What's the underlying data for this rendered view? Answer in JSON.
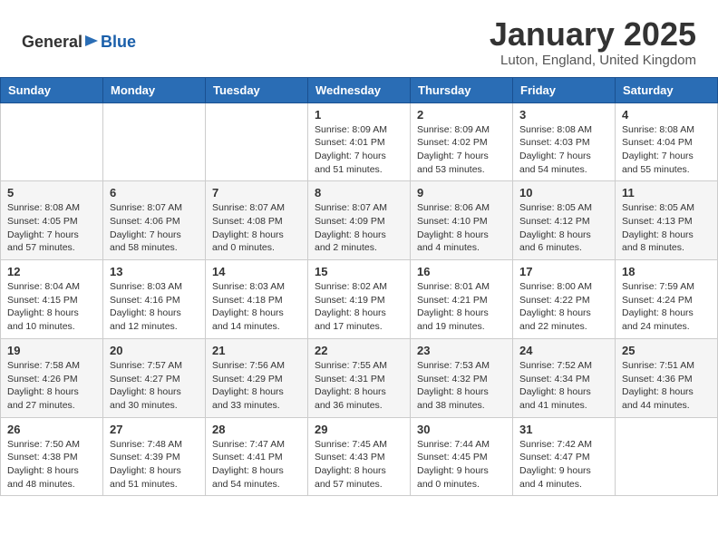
{
  "header": {
    "logo_general": "General",
    "logo_blue": "Blue",
    "month_title": "January 2025",
    "location": "Luton, England, United Kingdom"
  },
  "days_of_week": [
    "Sunday",
    "Monday",
    "Tuesday",
    "Wednesday",
    "Thursday",
    "Friday",
    "Saturday"
  ],
  "weeks": [
    [
      {
        "day": "",
        "info": ""
      },
      {
        "day": "",
        "info": ""
      },
      {
        "day": "",
        "info": ""
      },
      {
        "day": "1",
        "info": "Sunrise: 8:09 AM\nSunset: 4:01 PM\nDaylight: 7 hours\nand 51 minutes."
      },
      {
        "day": "2",
        "info": "Sunrise: 8:09 AM\nSunset: 4:02 PM\nDaylight: 7 hours\nand 53 minutes."
      },
      {
        "day": "3",
        "info": "Sunrise: 8:08 AM\nSunset: 4:03 PM\nDaylight: 7 hours\nand 54 minutes."
      },
      {
        "day": "4",
        "info": "Sunrise: 8:08 AM\nSunset: 4:04 PM\nDaylight: 7 hours\nand 55 minutes."
      }
    ],
    [
      {
        "day": "5",
        "info": "Sunrise: 8:08 AM\nSunset: 4:05 PM\nDaylight: 7 hours\nand 57 minutes."
      },
      {
        "day": "6",
        "info": "Sunrise: 8:07 AM\nSunset: 4:06 PM\nDaylight: 7 hours\nand 58 minutes."
      },
      {
        "day": "7",
        "info": "Sunrise: 8:07 AM\nSunset: 4:08 PM\nDaylight: 8 hours\nand 0 minutes."
      },
      {
        "day": "8",
        "info": "Sunrise: 8:07 AM\nSunset: 4:09 PM\nDaylight: 8 hours\nand 2 minutes."
      },
      {
        "day": "9",
        "info": "Sunrise: 8:06 AM\nSunset: 4:10 PM\nDaylight: 8 hours\nand 4 minutes."
      },
      {
        "day": "10",
        "info": "Sunrise: 8:05 AM\nSunset: 4:12 PM\nDaylight: 8 hours\nand 6 minutes."
      },
      {
        "day": "11",
        "info": "Sunrise: 8:05 AM\nSunset: 4:13 PM\nDaylight: 8 hours\nand 8 minutes."
      }
    ],
    [
      {
        "day": "12",
        "info": "Sunrise: 8:04 AM\nSunset: 4:15 PM\nDaylight: 8 hours\nand 10 minutes."
      },
      {
        "day": "13",
        "info": "Sunrise: 8:03 AM\nSunset: 4:16 PM\nDaylight: 8 hours\nand 12 minutes."
      },
      {
        "day": "14",
        "info": "Sunrise: 8:03 AM\nSunset: 4:18 PM\nDaylight: 8 hours\nand 14 minutes."
      },
      {
        "day": "15",
        "info": "Sunrise: 8:02 AM\nSunset: 4:19 PM\nDaylight: 8 hours\nand 17 minutes."
      },
      {
        "day": "16",
        "info": "Sunrise: 8:01 AM\nSunset: 4:21 PM\nDaylight: 8 hours\nand 19 minutes."
      },
      {
        "day": "17",
        "info": "Sunrise: 8:00 AM\nSunset: 4:22 PM\nDaylight: 8 hours\nand 22 minutes."
      },
      {
        "day": "18",
        "info": "Sunrise: 7:59 AM\nSunset: 4:24 PM\nDaylight: 8 hours\nand 24 minutes."
      }
    ],
    [
      {
        "day": "19",
        "info": "Sunrise: 7:58 AM\nSunset: 4:26 PM\nDaylight: 8 hours\nand 27 minutes."
      },
      {
        "day": "20",
        "info": "Sunrise: 7:57 AM\nSunset: 4:27 PM\nDaylight: 8 hours\nand 30 minutes."
      },
      {
        "day": "21",
        "info": "Sunrise: 7:56 AM\nSunset: 4:29 PM\nDaylight: 8 hours\nand 33 minutes."
      },
      {
        "day": "22",
        "info": "Sunrise: 7:55 AM\nSunset: 4:31 PM\nDaylight: 8 hours\nand 36 minutes."
      },
      {
        "day": "23",
        "info": "Sunrise: 7:53 AM\nSunset: 4:32 PM\nDaylight: 8 hours\nand 38 minutes."
      },
      {
        "day": "24",
        "info": "Sunrise: 7:52 AM\nSunset: 4:34 PM\nDaylight: 8 hours\nand 41 minutes."
      },
      {
        "day": "25",
        "info": "Sunrise: 7:51 AM\nSunset: 4:36 PM\nDaylight: 8 hours\nand 44 minutes."
      }
    ],
    [
      {
        "day": "26",
        "info": "Sunrise: 7:50 AM\nSunset: 4:38 PM\nDaylight: 8 hours\nand 48 minutes."
      },
      {
        "day": "27",
        "info": "Sunrise: 7:48 AM\nSunset: 4:39 PM\nDaylight: 8 hours\nand 51 minutes."
      },
      {
        "day": "28",
        "info": "Sunrise: 7:47 AM\nSunset: 4:41 PM\nDaylight: 8 hours\nand 54 minutes."
      },
      {
        "day": "29",
        "info": "Sunrise: 7:45 AM\nSunset: 4:43 PM\nDaylight: 8 hours\nand 57 minutes."
      },
      {
        "day": "30",
        "info": "Sunrise: 7:44 AM\nSunset: 4:45 PM\nDaylight: 9 hours\nand 0 minutes."
      },
      {
        "day": "31",
        "info": "Sunrise: 7:42 AM\nSunset: 4:47 PM\nDaylight: 9 hours\nand 4 minutes."
      },
      {
        "day": "",
        "info": ""
      }
    ]
  ]
}
